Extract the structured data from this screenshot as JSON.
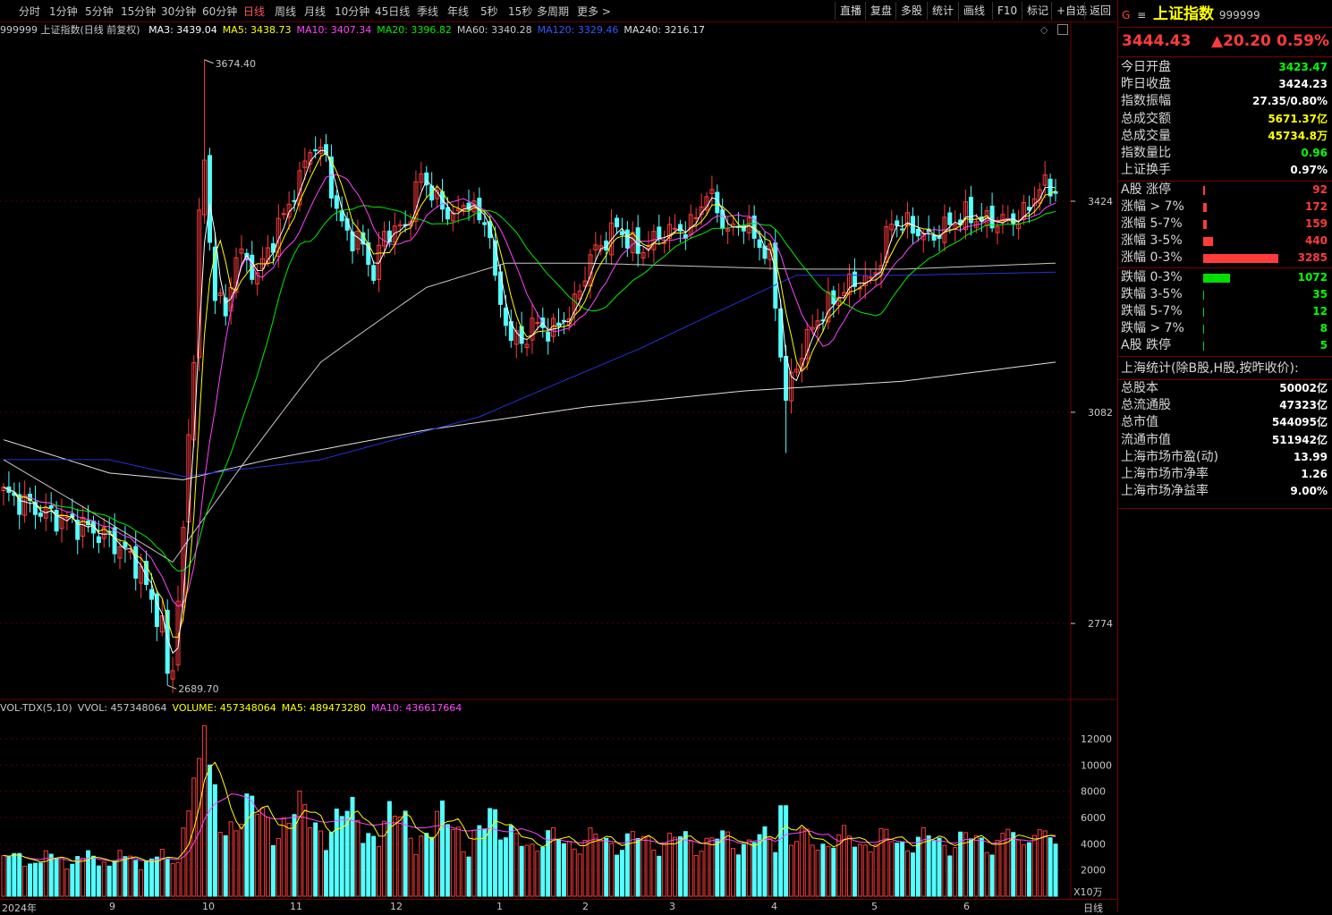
{
  "toolbar": {
    "timeframes": [
      "分时",
      "1分钟",
      "5分钟",
      "15分钟",
      "30分钟",
      "60分钟",
      "日线",
      "周线",
      "月线",
      "10分钟",
      "45日线",
      "季线",
      "年线",
      "5秒",
      "15秒",
      "多周期",
      "更多 >"
    ],
    "active": "日线",
    "right_buttons": [
      "直播",
      "复盘",
      "多股",
      "统计",
      "画线",
      "F10",
      "标记",
      "+自选",
      "返回"
    ]
  },
  "ma_legend": {
    "title": "999999 上证指数(日线 前复权)",
    "items": [
      {
        "label": "MA3: 3439.04",
        "color": "#ffffff"
      },
      {
        "label": "MA5: 3438.73",
        "color": "#ffff00"
      },
      {
        "label": "MA10: 3407.34",
        "color": "#ff44ff"
      },
      {
        "label": "MA20: 3396.82",
        "color": "#00ee00"
      },
      {
        "label": "MA60: 3340.28",
        "color": "#c8c8c8"
      },
      {
        "label": "MA120: 3329.46",
        "color": "#3355ff"
      },
      {
        "label": "MA240: 3216.17",
        "color": "#e0e0e0"
      }
    ]
  },
  "vol_legend": {
    "items": [
      {
        "label": "VOL-TDX(5,10)",
        "color": "#c8c8c8"
      },
      {
        "label": "VVOL: 457348064",
        "color": "#c8c8c8"
      },
      {
        "label": "VOLUME: 457348064",
        "color": "#ffff00"
      },
      {
        "label": "MA5: 489473280",
        "color": "#ffff00"
      },
      {
        "label": "MA10: 436617664",
        "color": "#ff44ff"
      }
    ]
  },
  "price_axis": {
    "labels": [
      "3424",
      "3082",
      "2774"
    ],
    "values": [
      3424,
      3082,
      2774
    ]
  },
  "vol_axis": {
    "labels": [
      "12000",
      "10000",
      "8000",
      "6000",
      "4000",
      "2000"
    ],
    "unit": "X10万"
  },
  "annotations": {
    "high": "3674.40",
    "low": "2689.70"
  },
  "x_axis": {
    "labels": [
      "2024年",
      "9",
      "10",
      "11",
      "12",
      "1",
      "2",
      "3",
      "4",
      "5",
      "6"
    ],
    "period": "日线"
  },
  "panel": {
    "g_label": "G",
    "menu_glyph": "≡",
    "name": "上证指数",
    "code": "999999",
    "price": "3444.43",
    "change": "▲20.20",
    "pct": "0.59%",
    "stats": [
      {
        "label": "今日开盘",
        "value": "3423.47",
        "color": "#00ff00"
      },
      {
        "label": "昨日收盘",
        "value": "3424.23",
        "color": "#ffffff"
      },
      {
        "label": "指数振幅",
        "value": "27.35/0.80%",
        "color": "#ffffff"
      },
      {
        "label": "总成交额",
        "value": "5671.37亿",
        "color": "#ffff00"
      },
      {
        "label": "总成交量",
        "value": "45734.8万",
        "color": "#ffff00"
      },
      {
        "label": "指数量比",
        "value": "0.96",
        "color": "#00ff00"
      },
      {
        "label": "上证换手",
        "value": "0.97%",
        "color": "#ffffff"
      }
    ],
    "ups": [
      {
        "label": "A股 涨停",
        "value": "92",
        "frac": 0.028
      },
      {
        "label": "涨幅 > 7%",
        "value": "172",
        "frac": 0.052
      },
      {
        "label": "涨幅 5-7%",
        "value": "159",
        "frac": 0.048
      },
      {
        "label": "涨幅 3-5%",
        "value": "440",
        "frac": 0.134
      },
      {
        "label": "涨幅 0-3%",
        "value": "3285",
        "frac": 1.0
      }
    ],
    "downs": [
      {
        "label": "跌幅 0-3%",
        "value": "1072",
        "frac": 0.326
      },
      {
        "label": "跌幅 3-5%",
        "value": "35",
        "frac": 0.011
      },
      {
        "label": "跌幅 5-7%",
        "value": "12",
        "frac": 0.004
      },
      {
        "label": "跌幅 > 7%",
        "value": "8",
        "frac": 0.003
      },
      {
        "label": "A股 跌停",
        "value": "5",
        "frac": 0.002
      }
    ],
    "sh_title": "上海统计(除B股,H股,按昨收价):",
    "sh": [
      {
        "label": "总股本",
        "value": "50002亿"
      },
      {
        "label": "总流通股",
        "value": "47323亿"
      },
      {
        "label": "总市值",
        "value": "544095亿"
      },
      {
        "label": "流通市值",
        "value": "511942亿"
      },
      {
        "label": "上海市场市盈(动)",
        "value": "13.99"
      },
      {
        "label": "上海市场市净率",
        "value": "1.26"
      },
      {
        "label": "上海市场净益率",
        "value": "9.00%"
      }
    ]
  },
  "colors": {
    "up": "#ff3b3b",
    "down": "#54ffff",
    "ma3": "#ffffff",
    "ma5": "#ffff00",
    "ma10": "#ff44ff",
    "ma20": "#00ee00",
    "ma60": "#c8c8c8",
    "ma120": "#2233dd",
    "ma240": "#e0e0e0",
    "grid": "#700000"
  }
}
